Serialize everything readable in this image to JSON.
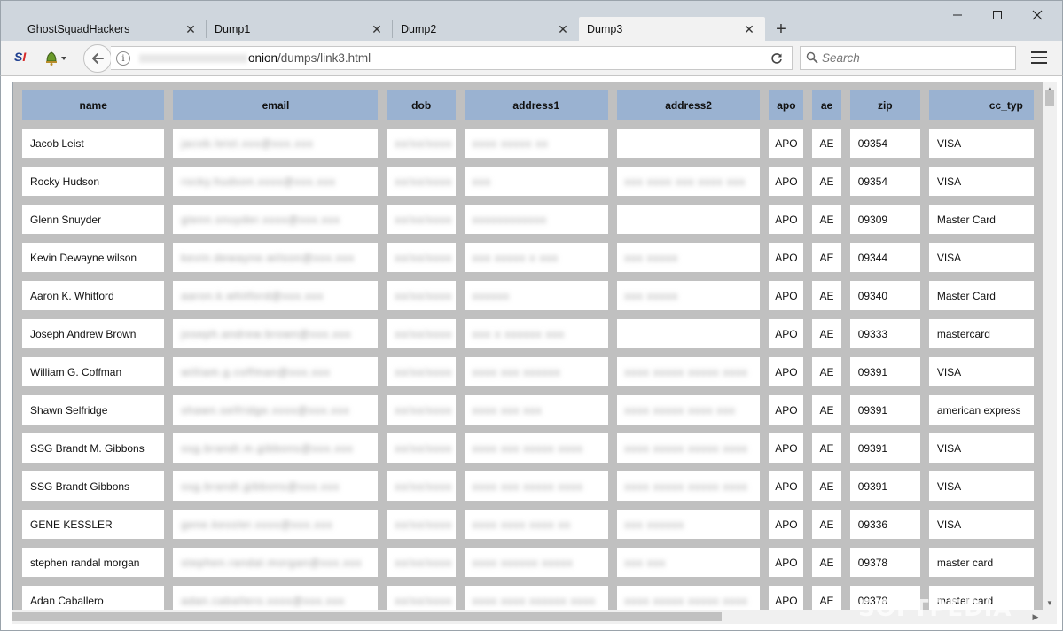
{
  "browser": {
    "tabs": [
      {
        "label": "GhostSquadHackers",
        "active": false
      },
      {
        "label": "Dump1",
        "active": false
      },
      {
        "label": "Dump2",
        "active": false
      },
      {
        "label": "Dump3",
        "active": true
      }
    ],
    "window_controls": {
      "minimize": "—",
      "maximize": "☐",
      "close": "✕"
    },
    "url": {
      "host": "onion",
      "path": "/dumps/link3.html"
    },
    "search": {
      "placeholder": "Search"
    },
    "extension_logo": {
      "s": "S",
      "i": "I"
    }
  },
  "table": {
    "columns": [
      "name",
      "email",
      "dob",
      "address1",
      "address2",
      "apo",
      "ae",
      "zip",
      "cc_typ"
    ],
    "rows": [
      {
        "name": "Jacob Leist",
        "email": "jacob.leist.xxx@xxx.xxx",
        "dob": "xx/xx/xxxx",
        "address1": "xxxx xxxxx xx",
        "address2": "",
        "apo": "APO",
        "ae": "AE",
        "zip": "09354",
        "cc_type": "VISA"
      },
      {
        "name": "Rocky Hudson",
        "email": "rocky.hudson.xxxx@xxx.xxx",
        "dob": "xx/xx/xxxx",
        "address1": "xxx",
        "address2": "xxx xxxx xxx xxxx xxx",
        "apo": "APO",
        "ae": "AE",
        "zip": "09354",
        "cc_type": "VISA"
      },
      {
        "name": "Glenn Snuyder",
        "email": "glenn.snuyder.xxxx@xxx.xxx",
        "dob": "xx/xx/xxxx",
        "address1": "xxxxxxxxxxxx",
        "address2": "",
        "apo": "APO",
        "ae": "AE",
        "zip": "09309",
        "cc_type": "Master Card"
      },
      {
        "name": "Kevin Dewayne wilson",
        "email": "kevin.dewayne.wilson@xxx.xxx",
        "dob": "xx/xx/xxxx",
        "address1": "xxx xxxxx x xxx",
        "address2": "xxx xxxxx",
        "apo": "APO",
        "ae": "AE",
        "zip": "09344",
        "cc_type": "VISA"
      },
      {
        "name": "Aaron K. Whitford",
        "email": "aaron.k.whitford@xxx.xxx",
        "dob": "xx/xx/xxxx",
        "address1": "xxxxxx",
        "address2": "xxx xxxxx",
        "apo": "APO",
        "ae": "AE",
        "zip": "09340",
        "cc_type": "Master Card"
      },
      {
        "name": "Joseph Andrew Brown",
        "email": "joseph.andrew.brown@xxx.xxx",
        "dob": "xx/xx/xxxx",
        "address1": "xxx x xxxxxx xxx",
        "address2": "",
        "apo": "APO",
        "ae": "AE",
        "zip": "09333",
        "cc_type": "mastercard"
      },
      {
        "name": "William G. Coffman",
        "email": "william.g.coffman@xxx.xxx",
        "dob": "xx/xx/xxxx",
        "address1": "xxxx xxx xxxxxx",
        "address2": "xxxx xxxxx xxxxx xxxx",
        "apo": "APO",
        "ae": "AE",
        "zip": "09391",
        "cc_type": "VISA"
      },
      {
        "name": "Shawn Selfridge",
        "email": "shawn.selfridge.xxxx@xxx.xxx",
        "dob": "xx/xx/xxxx",
        "address1": "xxxx xxx xxx",
        "address2": "xxxx xxxxx xxxx xxx",
        "apo": "APO",
        "ae": "AE",
        "zip": "09391",
        "cc_type": "american express"
      },
      {
        "name": "SSG Brandt M. Gibbons",
        "email": "ssg.brandt.m.gibbons@xxx.xxx",
        "dob": "xx/xx/xxxx",
        "address1": "xxxx xxx xxxxx xxxx",
        "address2": "xxxx xxxxx xxxxx xxxx",
        "apo": "APO",
        "ae": "AE",
        "zip": "09391",
        "cc_type": "VISA"
      },
      {
        "name": "SSG Brandt Gibbons",
        "email": "ssg.brandt.gibbons@xxx.xxx",
        "dob": "xx/xx/xxxx",
        "address1": "xxxx xxx xxxxx xxxx",
        "address2": "xxxx xxxxx xxxxx xxxx",
        "apo": "APO",
        "ae": "AE",
        "zip": "09391",
        "cc_type": "VISA"
      },
      {
        "name": "GENE KESSLER",
        "email": "gene.kessler.xxxx@xxx.xxx",
        "dob": "xx/xx/xxxx",
        "address1": "xxxx xxxx xxxx xx",
        "address2": "xxx xxxxxx",
        "apo": "APO",
        "ae": "AE",
        "zip": "09336",
        "cc_type": "VISA"
      },
      {
        "name": "stephen randal morgan",
        "email": "stephen.randal.morgan@xxx.xxx",
        "dob": "xx/xx/xxxx",
        "address1": "xxxx xxxxxx xxxxx",
        "address2": "xxx xxx",
        "apo": "APO",
        "ae": "AE",
        "zip": "09378",
        "cc_type": "master card"
      },
      {
        "name": "Adan Caballero",
        "email": "adan.caballero.xxxx@xxx.xxx",
        "dob": "xx/xx/xxxx",
        "address1": "xxxx xxxx xxxxxx xxxx",
        "address2": "xxxx xxxxx xxxxx xxxx",
        "apo": "APO",
        "ae": "AE",
        "zip": "09378",
        "cc_type": "master card"
      }
    ]
  },
  "watermark": "SOFTPEDIA",
  "colors": {
    "header_bg": "#9ab2d1",
    "grid_bg": "#c0c0c0",
    "cell_bg": "#ffffff",
    "tabstrip_bg": "#cfd6dd"
  }
}
